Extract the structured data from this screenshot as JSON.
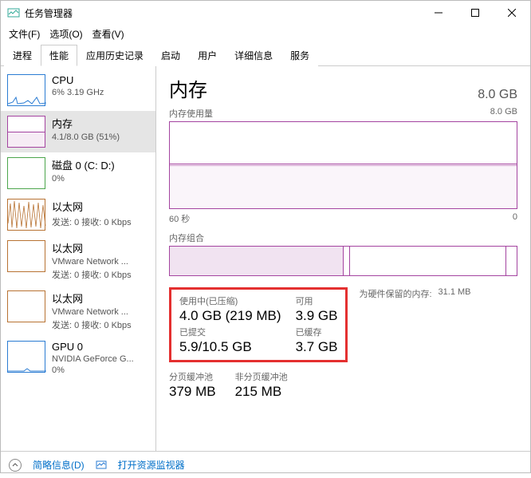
{
  "window": {
    "title": "任务管理器"
  },
  "menu": {
    "file": "文件(F)",
    "options": "选项(O)",
    "view": "查看(V)"
  },
  "tabs": {
    "processes": "进程",
    "performance": "性能",
    "appHistory": "应用历史记录",
    "startup": "启动",
    "users": "用户",
    "details": "详细信息",
    "services": "服务"
  },
  "sidebar": {
    "cpu": {
      "title": "CPU",
      "sub": "6%  3.19 GHz"
    },
    "memory": {
      "title": "内存",
      "sub": "4.1/8.0 GB (51%)"
    },
    "disk": {
      "title": "磁盘 0 (C: D:)",
      "sub": "0%"
    },
    "eth": {
      "title": "以太网",
      "sub": "发送: 0 接收: 0 Kbps"
    },
    "eth2": {
      "title": "以太网",
      "sub": "VMware Network ...",
      "sub2": "发送: 0 接收: 0 Kbps"
    },
    "eth3": {
      "title": "以太网",
      "sub": "VMware Network ...",
      "sub2": "发送: 0 接收: 0 Kbps"
    },
    "gpu": {
      "title": "GPU 0",
      "sub": "NVIDIA GeForce G...",
      "sub2": "0%"
    }
  },
  "detail": {
    "title": "内存",
    "total": "8.0 GB",
    "usageLabel": "内存使用量",
    "usageMax": "8.0 GB",
    "axisLeft": "60 秒",
    "axisRight": "0",
    "compLabel": "内存组合",
    "inUseLabel": "使用中(已压缩)",
    "inUseValue": "4.0 GB (219 MB)",
    "availLabel": "可用",
    "availValue": "3.9 GB",
    "commitLabel": "已提交",
    "commitValue": "5.9/10.5 GB",
    "cachedLabel": "已缓存",
    "cachedValue": "3.7 GB",
    "reservedLabel": "为硬件保留的内存:",
    "reservedValue": "31.1 MB",
    "pagedLabel": "分页缓冲池",
    "pagedValue": "379 MB",
    "nonpagedLabel": "非分页缓冲池",
    "nonpagedValue": "215 MB"
  },
  "footer": {
    "fewer": "简略信息(D)",
    "resmon": "打开资源监视器"
  }
}
